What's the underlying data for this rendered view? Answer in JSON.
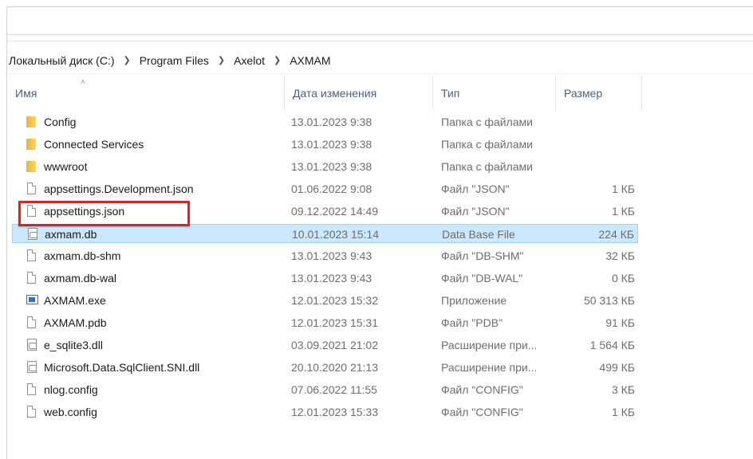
{
  "breadcrumb": [
    "Локальный диск (C:)",
    "Program Files",
    "Axelot",
    "AXMAM"
  ],
  "columns": {
    "name": "Имя",
    "date": "Дата изменения",
    "type": "Тип",
    "size": "Размер"
  },
  "files": [
    {
      "name": "Config",
      "date": "13.01.2023 9:38",
      "type": "Папка с файлами",
      "size": "",
      "icon": "folder-icon"
    },
    {
      "name": "Connected Services",
      "date": "13.01.2023 9:38",
      "type": "Папка с файлами",
      "size": "",
      "icon": "folder-icon"
    },
    {
      "name": "wwwroot",
      "date": "13.01.2023 9:38",
      "type": "Папка с файлами",
      "size": "",
      "icon": "folder-icon"
    },
    {
      "name": "appsettings.Development.json",
      "date": "01.06.2022 9:08",
      "type": "Файл \"JSON\"",
      "size": "1 КБ",
      "icon": "file-icon"
    },
    {
      "name": "appsettings.json",
      "date": "09.12.2022 14:49",
      "type": "Файл \"JSON\"",
      "size": "1 КБ",
      "icon": "file-icon"
    },
    {
      "name": "axmam.db",
      "date": "10.01.2023 15:14",
      "type": "Data Base File",
      "size": "224 КБ",
      "icon": "database-file-icon",
      "selected": true
    },
    {
      "name": "axmam.db-shm",
      "date": "13.01.2023 9:43",
      "type": "Файл \"DB-SHM\"",
      "size": "32 КБ",
      "icon": "file-icon"
    },
    {
      "name": "axmam.db-wal",
      "date": "13.01.2023 9:43",
      "type": "Файл \"DB-WAL\"",
      "size": "0 КБ",
      "icon": "file-icon"
    },
    {
      "name": "AXMAM.exe",
      "date": "12.01.2023 15:32",
      "type": "Приложение",
      "size": "50 313 КБ",
      "icon": "application-icon"
    },
    {
      "name": "AXMAM.pdb",
      "date": "12.01.2023 15:31",
      "type": "Файл \"PDB\"",
      "size": "91 КБ",
      "icon": "file-icon"
    },
    {
      "name": "e_sqlite3.dll",
      "date": "03.09.2021 21:02",
      "type": "Расширение при...",
      "size": "1 564 КБ",
      "icon": "dll-icon"
    },
    {
      "name": "Microsoft.Data.SqlClient.SNI.dll",
      "date": "20.10.2020 21:13",
      "type": "Расширение при...",
      "size": "499 КБ",
      "icon": "dll-icon"
    },
    {
      "name": "nlog.config",
      "date": "07.06.2022 11:55",
      "type": "Файл \"CONFIG\"",
      "size": "3 КБ",
      "icon": "file-icon"
    },
    {
      "name": "web.config",
      "date": "12.01.2023 15:33",
      "type": "Файл \"CONFIG\"",
      "size": "1 КБ",
      "icon": "file-icon"
    }
  ],
  "colors": {
    "selection": "#cce8ff",
    "highlight_box": "#d7261e"
  }
}
